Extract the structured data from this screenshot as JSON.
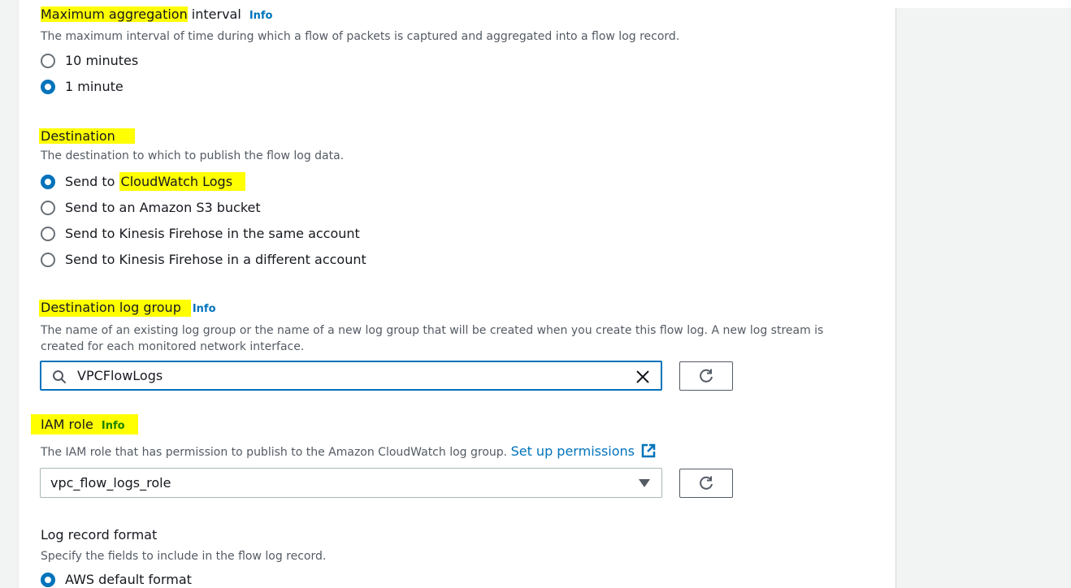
{
  "aggregation": {
    "label_highlight": "Maximum aggregation",
    "label_rest": " interval",
    "info": "Info",
    "description": "The maximum interval of time during which a flow of packets is captured and aggregated into a flow log record.",
    "options": [
      "10 minutes",
      "1 minute"
    ],
    "selected": "1 minute"
  },
  "destination": {
    "label": "Destination",
    "description": "The destination to which to publish the flow log data.",
    "options": {
      "cloudwatch_prefix": "Send to ",
      "cloudwatch_highlight": "CloudWatch Logs",
      "s3": "Send to an Amazon S3 bucket",
      "firehose_same": "Send to Kinesis Firehose in the same account",
      "firehose_diff": "Send to Kinesis Firehose in a different account"
    },
    "selected": "Send to CloudWatch Logs"
  },
  "log_group": {
    "label": "Destination log group",
    "info": "Info",
    "description_line1": "The name of an existing log group or the name of a new log group that will be created when you create this flow log. A new log stream is",
    "description_line2": "created for each monitored network interface.",
    "value": "VPCFlowLogs"
  },
  "iam_role": {
    "label": "IAM role",
    "info": "Info",
    "description": "The IAM role that has permission to publish to the Amazon CloudWatch log group.",
    "link": "Set up permissions",
    "value": "vpc_flow_logs_role"
  },
  "log_format": {
    "label": "Log record format",
    "description": "Specify the fields to include in the flow log record.",
    "options": [
      "AWS default format"
    ],
    "selected": "AWS default format"
  },
  "colors": {
    "accent": "#0073bb",
    "highlight": "#ffff00",
    "info_iam": "#1d8102"
  }
}
